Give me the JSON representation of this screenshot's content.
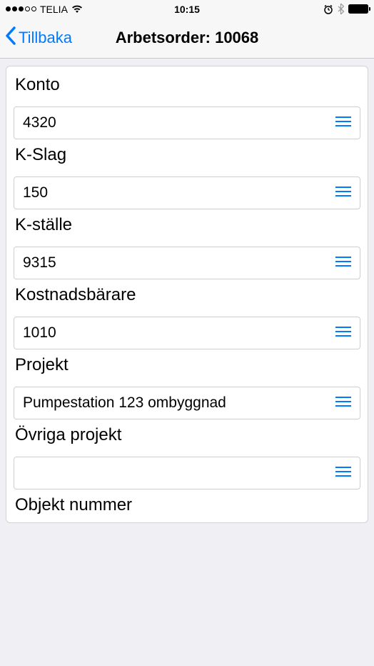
{
  "statusBar": {
    "carrier": "TELIA",
    "time": "10:15"
  },
  "nav": {
    "back": "Tillbaka",
    "title": "Arbetsorder: 10068"
  },
  "fields": {
    "konto": {
      "label": "Konto",
      "value": "4320"
    },
    "kslag": {
      "label": "K-Slag",
      "value": "150"
    },
    "kstalle": {
      "label": "K-ställe",
      "value": "9315"
    },
    "kostnadsbarare": {
      "label": "Kostnadsbärare",
      "value": "1010"
    },
    "projekt": {
      "label": "Projekt",
      "value": "Pumpestation 123 ombyggnad"
    },
    "ovrigaprojekt": {
      "label": "Övriga projekt",
      "value": ""
    },
    "objektnummer": {
      "label": "Objekt nummer"
    }
  }
}
